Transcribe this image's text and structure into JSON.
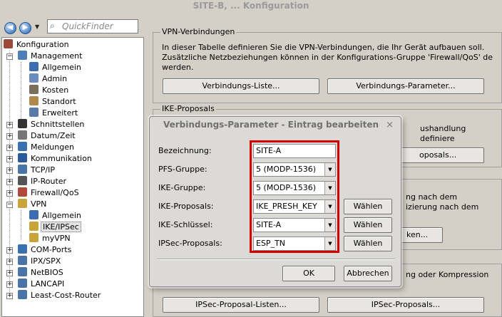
{
  "window": {
    "title": "SITE-B, ... Konfiguration"
  },
  "toolbar": {
    "back": "◀",
    "forward": "▶",
    "search_placeholder": "QuickFinder"
  },
  "tree": [
    {
      "label": "Konfiguration",
      "level": 0,
      "icon": "wrench-icon",
      "color": "#9c4a3a",
      "expander": "",
      "selected": false
    },
    {
      "label": "Management",
      "level": 1,
      "icon": "computer-icon",
      "color": "#4e7fb6",
      "expander": "−",
      "selected": false
    },
    {
      "label": "Allgemein",
      "level": 2,
      "icon": "gear-icon",
      "color": "#3c6db0",
      "expander": "",
      "selected": false
    },
    {
      "label": "Admin",
      "level": 2,
      "icon": "user-icon",
      "color": "#6b8cc0",
      "expander": "",
      "selected": false
    },
    {
      "label": "Kosten",
      "level": 2,
      "icon": "coins-icon",
      "color": "#7a6f5a",
      "expander": "",
      "selected": false
    },
    {
      "label": "Standort",
      "level": 2,
      "icon": "location-icon",
      "color": "#b08a4a",
      "expander": "",
      "selected": false
    },
    {
      "label": "Erweitert",
      "level": 2,
      "icon": "advanced-icon",
      "color": "#5a7aa8",
      "expander": "",
      "selected": false
    },
    {
      "label": "Schnittstellen",
      "level": 1,
      "icon": "interfaces-icon",
      "color": "#333333",
      "expander": "+",
      "selected": false
    },
    {
      "label": "Datum/Zeit",
      "level": 1,
      "icon": "clock-icon",
      "color": "#777777",
      "expander": "+",
      "selected": false
    },
    {
      "label": "Meldungen",
      "level": 1,
      "icon": "messages-icon",
      "color": "#3a6fb0",
      "expander": "+",
      "selected": false
    },
    {
      "label": "Kommunikation",
      "level": 1,
      "icon": "communication-icon",
      "color": "#2a5a9a",
      "expander": "+",
      "selected": false
    },
    {
      "label": "TCP/IP",
      "level": 1,
      "icon": "network-icon",
      "color": "#4a74a8",
      "expander": "+",
      "selected": false
    },
    {
      "label": "IP-Router",
      "level": 1,
      "icon": "router-icon",
      "color": "#555555",
      "expander": "+",
      "selected": false
    },
    {
      "label": "Firewall/QoS",
      "level": 1,
      "icon": "firewall-icon",
      "color": "#b04a3a",
      "expander": "+",
      "selected": false
    },
    {
      "label": "VPN",
      "level": 1,
      "icon": "vpn-lock-icon",
      "color": "#c9a43a",
      "expander": "−",
      "selected": false
    },
    {
      "label": "Allgemein",
      "level": 2,
      "icon": "gear-icon",
      "color": "#3c6db0",
      "expander": "",
      "selected": false
    },
    {
      "label": "IKE/IPSec",
      "level": 2,
      "icon": "key-icon",
      "color": "#c9a43a",
      "expander": "",
      "selected": true
    },
    {
      "label": "myVPN",
      "level": 2,
      "icon": "key-icon",
      "color": "#c9a43a",
      "expander": "",
      "selected": false
    },
    {
      "label": "COM-Ports",
      "level": 1,
      "icon": "ports-icon",
      "color": "#3a6fb0",
      "expander": "+",
      "selected": false
    },
    {
      "label": "IPX/SPX",
      "level": 1,
      "icon": "protocol-icon",
      "color": "#4a74a8",
      "expander": "+",
      "selected": false
    },
    {
      "label": "NetBIOS",
      "level": 1,
      "icon": "netbios-icon",
      "color": "#4a74a8",
      "expander": "+",
      "selected": false
    },
    {
      "label": "LANCAPI",
      "level": 1,
      "icon": "lancapi-icon",
      "color": "#4a74a8",
      "expander": "+",
      "selected": false
    },
    {
      "label": "Least-Cost-Router",
      "level": 1,
      "icon": "lcr-icon",
      "color": "#4a74a8",
      "expander": "+",
      "selected": false
    }
  ],
  "vpn_group": {
    "title": "VPN-Verbindungen",
    "description": "In dieser Tabelle definieren Sie die VPN-Verbindungen, die Ihr Gerät aufbauen soll. Zusätzliche Netzbeziehungen können in der Konfigurations-Gruppe 'Firewall/QoS' de werden.",
    "btn_list": "Verbindungs-Liste...",
    "btn_params": "Verbindungs-Parameter..."
  },
  "ike_group": {
    "title": "IKE-Proposals",
    "partial_text": "ushandlung definiere",
    "btn_partial": "oposals..."
  },
  "hidden_group": {
    "partial_text_1": "ng nach dem",
    "partial_text_2": "izierung nach dem",
    "btn_partial": "ken..."
  },
  "ipsec_group": {
    "partial_text": "ng oder Kompression",
    "btn_list": "IPSec-Proposal-Listen...",
    "btn_proposals": "IPSec-Proposals..."
  },
  "dialog": {
    "title": "Verbindungs-Parameter - Eintrag bearbeiten",
    "close": "×",
    "fields": [
      {
        "label": "Bezeichnung:",
        "value": "SITE-A",
        "type": "text",
        "has_select": false
      },
      {
        "label": "PFS-Gruppe:",
        "value": "5 (MODP-1536)",
        "type": "combo",
        "has_select": false
      },
      {
        "label": "IKE-Gruppe:",
        "value": "5 (MODP-1536)",
        "type": "combo",
        "has_select": false
      },
      {
        "label": "IKE-Proposals:",
        "value": "IKE_PRESH_KEY",
        "type": "combo",
        "has_select": true
      },
      {
        "label": "IKE-Schlüssel:",
        "value": "SITE-A",
        "type": "combo",
        "has_select": true
      },
      {
        "label": "IPSec-Proposals:",
        "value": "ESP_TN",
        "type": "combo",
        "has_select": true
      }
    ],
    "select_label": "Wählen",
    "ok": "OK",
    "cancel": "Abbrechen",
    "highlight_color": "#d40000"
  }
}
